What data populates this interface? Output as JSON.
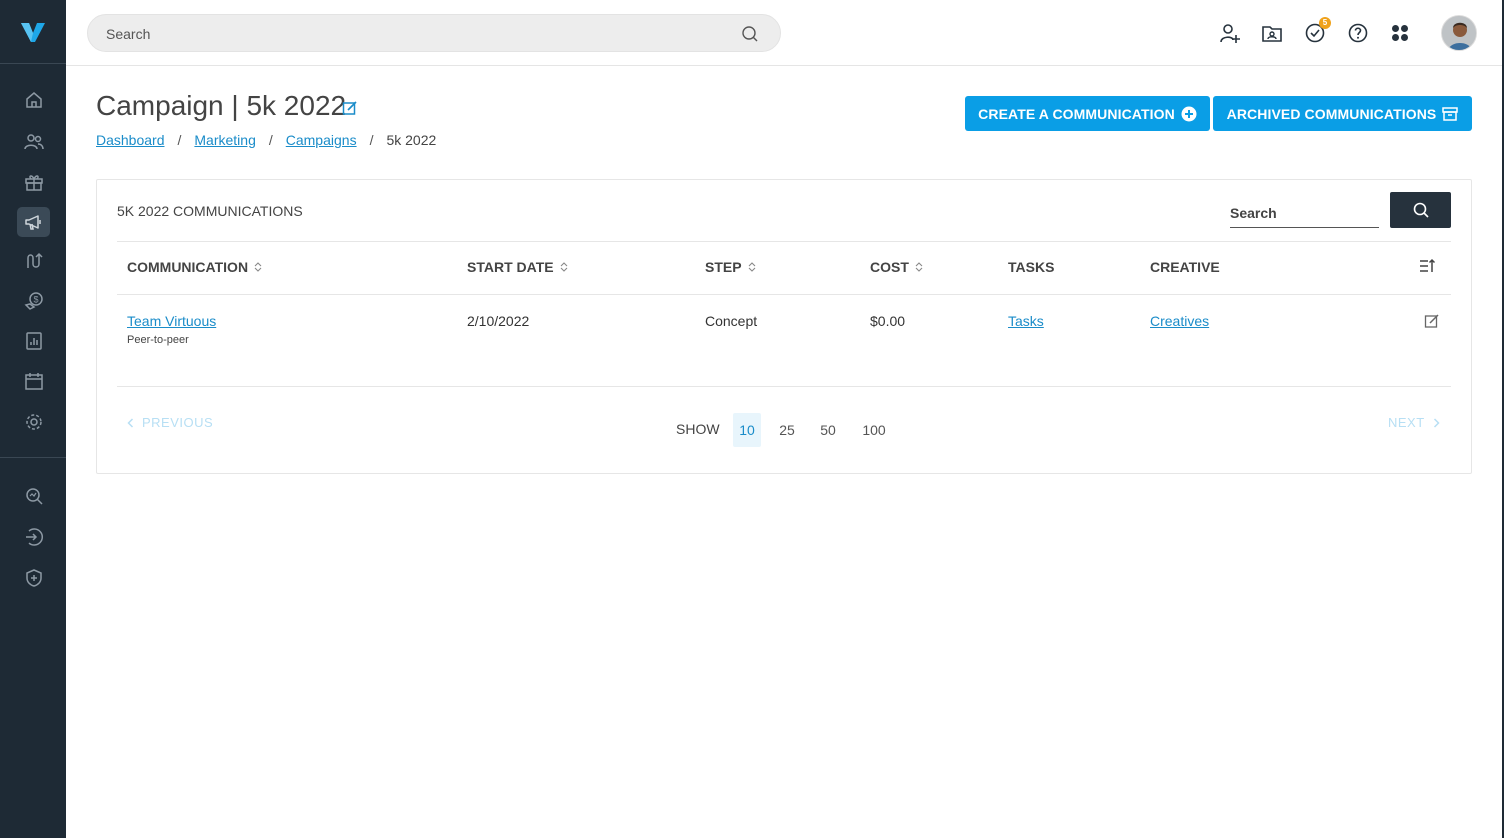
{
  "topbar": {
    "search_placeholder": "Search",
    "tasks_badge": "5"
  },
  "sidebar": {
    "items": [
      {
        "icon": "home-icon"
      },
      {
        "icon": "people-icon"
      },
      {
        "icon": "gift-icon"
      },
      {
        "icon": "megaphone-icon",
        "active": true
      },
      {
        "icon": "journey-icon"
      },
      {
        "icon": "donation-icon"
      },
      {
        "icon": "report-icon"
      },
      {
        "icon": "calendar-icon"
      },
      {
        "icon": "settings-icon"
      },
      {
        "icon": "query-icon"
      },
      {
        "icon": "import-icon"
      },
      {
        "icon": "shield-icon"
      }
    ]
  },
  "header": {
    "title": "Campaign | 5k 2022",
    "breadcrumb": [
      "Dashboard",
      "Marketing",
      "Campaigns",
      "5k 2022"
    ],
    "breadcrumb_sep": "/",
    "create_button": "CREATE A COMMUNICATION",
    "archived_button": "ARCHIVED COMMUNICATIONS"
  },
  "card": {
    "title": "5K 2022 COMMUNICATIONS",
    "search_placeholder": "Search",
    "columns": [
      "COMMUNICATION",
      "START DATE",
      "STEP",
      "COST",
      "TASKS",
      "CREATIVE"
    ],
    "rows": [
      {
        "communication": "Team Virtuous",
        "type": "Peer-to-peer",
        "start_date": "2/10/2022",
        "step": "Concept",
        "cost": "$0.00",
        "tasks": "Tasks",
        "creative": "Creatives"
      }
    ],
    "pagination": {
      "previous": "PREVIOUS",
      "next": "NEXT",
      "show_label": "SHOW",
      "sizes": [
        "10",
        "25",
        "50",
        "100"
      ],
      "selected": "10"
    }
  },
  "colors": {
    "sidebar_bg": "#1e2a35",
    "primary": "#0a9ee6",
    "link": "#1a8cc9",
    "badge": "#f0a21b"
  }
}
